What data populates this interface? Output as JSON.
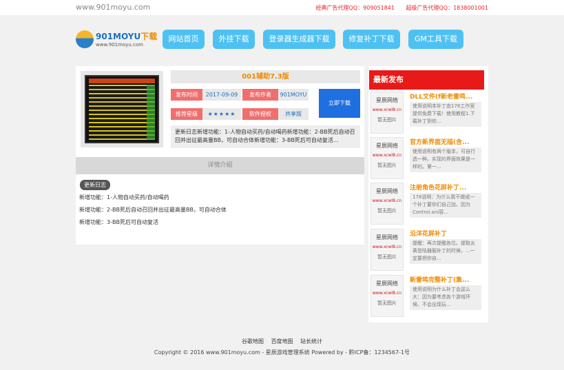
{
  "topbar": {
    "domain": "www.901moyu.com",
    "ad_1": "经典广告代理QQ：909051841",
    "ad_2": "超级广告代理QQ：1838001001"
  },
  "logo": {
    "name": "901MOYU",
    "name_suffix": "下载",
    "url": "www.901moyu.com"
  },
  "nav": [
    {
      "label": "网站首页"
    },
    {
      "label": "外挂下载"
    },
    {
      "label": "登录器生成器下载"
    },
    {
      "label": "修复补丁下载"
    },
    {
      "label": "GM工具下载"
    }
  ],
  "article": {
    "title": "001辅助7.3版",
    "date_label": "发布时间",
    "date": "2017-09-09",
    "author_label": "发布作者",
    "author": "901MOYU",
    "rating_label": "推荐星级",
    "rating": "★★★★★",
    "license_label": "软件授权",
    "license": "共享版",
    "download_label": "立即下载",
    "description": "更新日志新增功能：1-人物自动买药/自动喝药新增功能：2-BB死后自动召回并出征最高量BB，可自动合体新增功能：3-BB死后可自动复活..."
  },
  "detail": {
    "header": "详情介绍",
    "badge": "更新日志",
    "lines": [
      "新增功能：1-人物自动买药/自动喝药",
      "新增功能：2-BB死后自动召回并出征最高量BB，可自动合体",
      "新增功能：3-BB死后可自动复活"
    ]
  },
  "sidebar": {
    "header": "最新发布",
    "thumb_brand": "星辰网络",
    "thumb_site": "www.xcwl8.cn",
    "thumb_note": "暂无图片",
    "items": [
      {
        "title": "DLL文件(f新老雷鸣...",
        "summary": "使用说明本补丁由178工作室提供免费下载！使用教程1.下载补丁到你..."
      },
      {
        "title": "官方新界面无描(含...",
        "summary": "使用说明有两个版本，可自行选一种。实现的界面效果是一样的。第一..."
      },
      {
        "title": "注册角色花屏补丁...",
        "summary": "178说明：为什么我不做成一个补丁要你们自己加，因为Control.ani容..."
      },
      {
        "title": "沿洋花屏补丁",
        "summary": "提醒：再次提醒各位。提取炎黄登陆器服补丁的时候，...一定要把你自..."
      },
      {
        "title": "新雷鸣完整补丁(集...",
        "summary": "使用说明为什么补丁会这么大：因为要考虑各个游戏环境、不会出现玩..."
      }
    ]
  },
  "footer": {
    "links": [
      "谷歌地图",
      "百度地图",
      "站长统计"
    ],
    "copyright": "Copyright © 2016 www.901moyu.com - 星辰游戏管理系统 Powered by - 黔ICP备：1234567-1号"
  },
  "colors": {
    "nav_bg": "#4ec1f3",
    "accent_orange": "#f08a00",
    "label_red": "#ef6f6f",
    "sidebar_head_red": "#e81919",
    "download_blue": "#1f6fe0"
  }
}
